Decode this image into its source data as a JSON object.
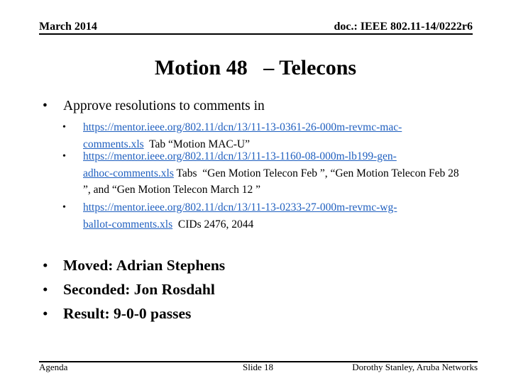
{
  "header": {
    "date": "March 2014",
    "doc_id": "doc.: IEEE 802.11-14/0222r6"
  },
  "title": "Motion 48   – Telecons",
  "main_bullet": "Approve resolutions to comments in",
  "sub_items": [
    {
      "link_line1": "https://mentor.ieee.org/802.11/dcn/13/11-13-0361-26-000m-revmc-mac-",
      "link_line2": "comments.xls",
      "text": "  Tab “Motion MAC-U”"
    },
    {
      "link_line1": "https://mentor.ieee.org/802.11/dcn/13/11-13-1160-08-000m-lb199-gen-",
      "link_line2": "adhoc-comments.xls",
      "text": " Tabs  “Gen Motion Telecon Feb ”, “Gen Motion Telecon Feb 28 ”, and “Gen Motion Telecon March 12 ”"
    },
    {
      "link_line1": "https://mentor.ieee.org/802.11/dcn/13/11-13-0233-27-000m-revmc-wg-",
      "link_line2": "ballot-comments.xls",
      "text": "  CIDs 2476, 2044"
    }
  ],
  "motion_results": [
    "Moved: Adrian Stephens",
    "Seconded: Jon Rosdahl",
    "Result: 9-0-0 passes"
  ],
  "bullet_glyph": "•",
  "link_color": "#1f5fbf",
  "footer": {
    "left": "Agenda",
    "center": "Slide 18",
    "right": "Dorothy Stanley, Aruba Networks"
  }
}
